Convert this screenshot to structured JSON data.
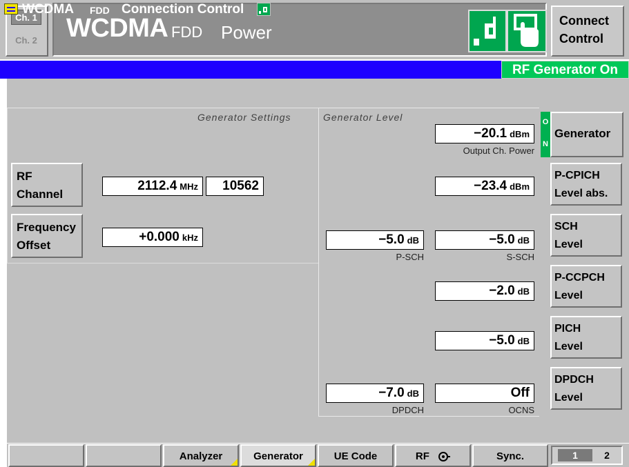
{
  "top": {
    "ch1": "Ch. 1",
    "ch2": "Ch. 2",
    "title_main": "WCDMA",
    "title_fdd": "FDD",
    "title_power": "Power",
    "connect_line1": "Connect",
    "connect_line2": "Control"
  },
  "header": {
    "wcdma": "WCDMA",
    "fdd": "FDD",
    "connection_control": "Connection Control",
    "status": "RF Generator On",
    "colors": {
      "bar": "#1e00ff",
      "status": "#00c858"
    }
  },
  "sections": {
    "generator_settings": "Generator Settings",
    "generator_level": "Generator Level"
  },
  "left_buttons": {
    "rf_channel": [
      "RF",
      "Channel"
    ],
    "frequency_offset": [
      "Frequency",
      "Offset"
    ]
  },
  "settings": {
    "rf_freq_value": "2112.4",
    "rf_freq_unit": "MHz",
    "rf_channel_number": "10562",
    "freq_offset_value": "+0.000",
    "freq_offset_unit": "kHz"
  },
  "levels": {
    "output_ch_power": {
      "value": "−20.1",
      "unit": "dBm",
      "label": "Output Ch. Power"
    },
    "p_cpich": {
      "value": "−23.4",
      "unit": "dBm"
    },
    "p_sch": {
      "value": "−5.0",
      "unit": "dB",
      "label": "P-SCH"
    },
    "s_sch": {
      "value": "−5.0",
      "unit": "dB",
      "label": "S-SCH"
    },
    "p_ccpch": {
      "value": "−2.0",
      "unit": "dB"
    },
    "pich": {
      "value": "−5.0",
      "unit": "dB"
    },
    "dpdch": {
      "value": "−7.0",
      "unit": "dB",
      "label": "DPDCH"
    },
    "ocns": {
      "value": "Off",
      "label": "OCNS"
    }
  },
  "side_buttons": {
    "generator_on_top": "O",
    "generator_on_bottom": "N",
    "generator": "Generator",
    "p_cpich": [
      "P-CPICH",
      "Level abs."
    ],
    "sch": [
      "SCH",
      "Level"
    ],
    "p_ccpch": [
      "P-CCPCH",
      "Level"
    ],
    "pich": [
      "PICH",
      "Level"
    ],
    "dpdch": [
      "DPDCH",
      "Level"
    ]
  },
  "tabs": {
    "analyzer": "Analyzer",
    "generator": "Generator",
    "ue_code": "UE Code",
    "rf": "RF",
    "sync": "Sync.",
    "page1": "1",
    "page2": "2"
  }
}
